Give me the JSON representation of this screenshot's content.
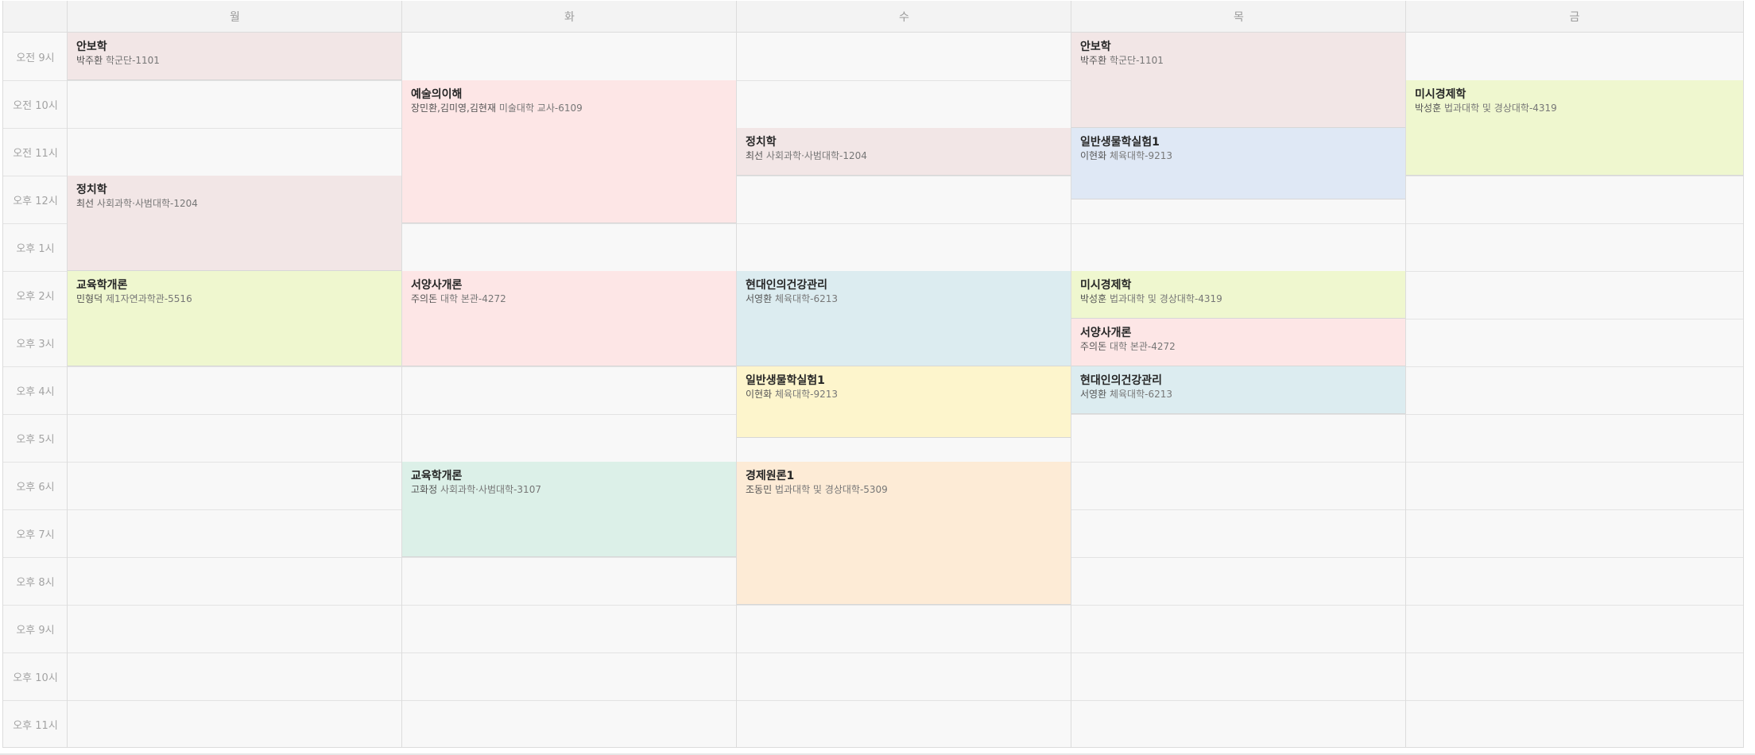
{
  "days": [
    "월",
    "화",
    "수",
    "목",
    "금"
  ],
  "times": [
    "오전 9시",
    "오전 10시",
    "오전 11시",
    "오후 12시",
    "오후 1시",
    "오후 2시",
    "오후 3시",
    "오후 4시",
    "오후 5시",
    "오후 6시",
    "오후 7시",
    "오후 8시",
    "오후 9시",
    "오후 10시",
    "오후 11시"
  ],
  "events": [
    {
      "title": "안보학",
      "prof": "박주환",
      "room": "학군단-1101",
      "color": "#f2e6e6"
    },
    {
      "title": "정치학",
      "prof": "최선",
      "room": "사회과학·사범대학-1204",
      "color": "#f2e6e6"
    },
    {
      "title": "교육학개론",
      "prof": "민형덕",
      "room": "제1자연과학관-5516",
      "color": "#eff7cf"
    },
    {
      "title": "예술의이해",
      "prof": "장민환,김미영,김현재",
      "room": "미술대학 교사-6109",
      "color": "#fde6e6"
    },
    {
      "title": "서양사개론",
      "prof": "주의돈",
      "room": "대학 본관-4272",
      "color": "#fde6e6"
    },
    {
      "title": "교육학개론",
      "prof": "고화정",
      "room": "사회과학·사범대학-3107",
      "color": "#dcf0e8"
    },
    {
      "title": "정치학",
      "prof": "최선",
      "room": "사회과학·사범대학-1204",
      "color": "#f2e6e6"
    },
    {
      "title": "현대인의건강관리",
      "prof": "서영환",
      "room": "체육대학-6213",
      "color": "#dcecf0"
    },
    {
      "title": "일반생물학실험1",
      "prof": "이현화",
      "room": "체육대학-9213",
      "color": "#fdf5cc"
    },
    {
      "title": "경제원론1",
      "prof": "조동민",
      "room": "법과대학 및 경상대학-5309",
      "color": "#fdebd6"
    },
    {
      "title": "안보학",
      "prof": "박주환",
      "room": "학군단-1101",
      "color": "#f2e6e6"
    },
    {
      "title": "일반생물학실험1",
      "prof": "이현화",
      "room": "체육대학-9213",
      "color": "#dfe8f5"
    },
    {
      "title": "미시경제학",
      "prof": "박성훈",
      "room": "법과대학 및 경상대학-4319",
      "color": "#eff7cf"
    },
    {
      "title": "서양사개론",
      "prof": "주의돈",
      "room": "대학 본관-4272",
      "color": "#fde6e6"
    },
    {
      "title": "현대인의건강관리",
      "prof": "서영환",
      "room": "체육대학-6213",
      "color": "#dcecf0"
    },
    {
      "title": "미시경제학",
      "prof": "박성훈",
      "room": "법과대학 및 경상대학-4319",
      "color": "#eff7cf"
    }
  ]
}
